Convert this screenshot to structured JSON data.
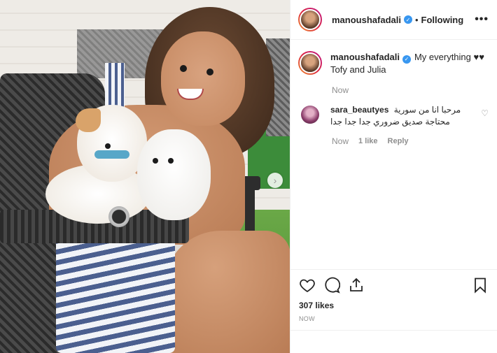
{
  "post": {
    "username": "manoushafadali",
    "follow_status": "Following",
    "separator": "•",
    "more_label": "•••"
  },
  "caption": {
    "username": "manoushafadali",
    "line1": "My everything ♥♥",
    "line2": "Tofy and Julia",
    "time": "Now"
  },
  "comments": [
    {
      "username": "sara_beautyes",
      "text_line1": "مرحبا انا من سورية",
      "text_line2": "محتاجة صديق ضروري جدا جدا جدا",
      "time": "Now",
      "likes": "1 like",
      "reply": "Reply"
    }
  ],
  "actions": {
    "likes": "307 likes",
    "timestamp": "NOW"
  },
  "icons": {
    "verified": "verified-badge-icon",
    "heart": "heart-icon",
    "comment": "comment-icon",
    "share": "share-icon",
    "bookmark": "bookmark-icon",
    "next": "chevron-right-icon",
    "more": "more-options-icon"
  },
  "colors": {
    "accent": "#3897f0",
    "text": "#262626",
    "muted": "#8e8e8e",
    "border": "#efefef"
  }
}
